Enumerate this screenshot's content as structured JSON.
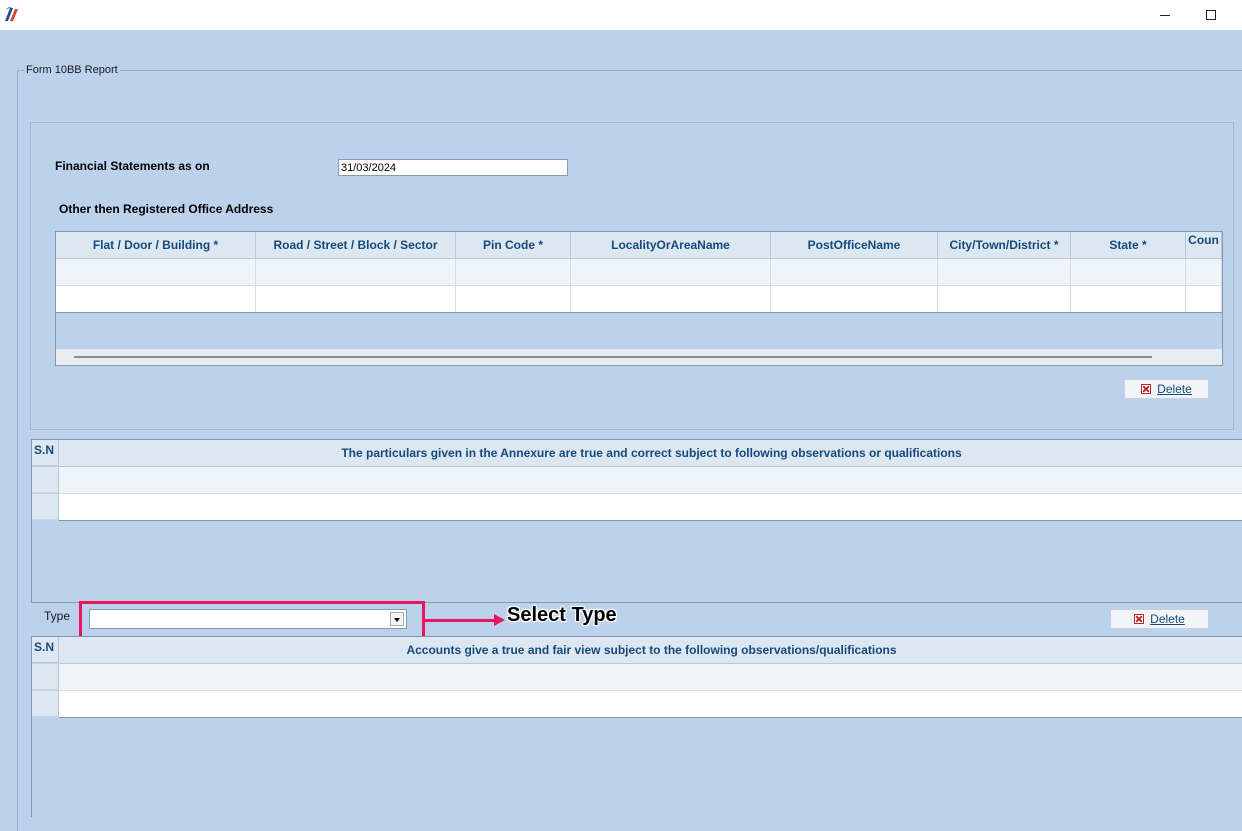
{
  "window": {
    "app_icon": "app-logo-icon"
  },
  "group": {
    "legend": "Form 10BB Report"
  },
  "financial": {
    "label": "Financial Statements as on",
    "date_value": "31/03/2024"
  },
  "address": {
    "label": "Other then Registered Office Address",
    "columns": [
      "Flat / Door / Building *",
      "Road / Street / Block / Sector",
      "Pin Code *",
      "LocalityOrAreaName",
      "PostOfficeName",
      "City/Town/District *",
      "State *",
      "Coun"
    ],
    "delete_label": "Delete"
  },
  "particulars": {
    "sn_header": "S.N",
    "header": "The particulars given in the Annexure are true and correct subject to following observations or qualifications"
  },
  "type": {
    "label": "Type",
    "selected": ""
  },
  "callout": {
    "text": "Select Type"
  },
  "accounts": {
    "sn_header": "S.N",
    "header": "Accounts give a true and fair view subject to the following observations/qualifications",
    "delete_label": "Delete"
  }
}
